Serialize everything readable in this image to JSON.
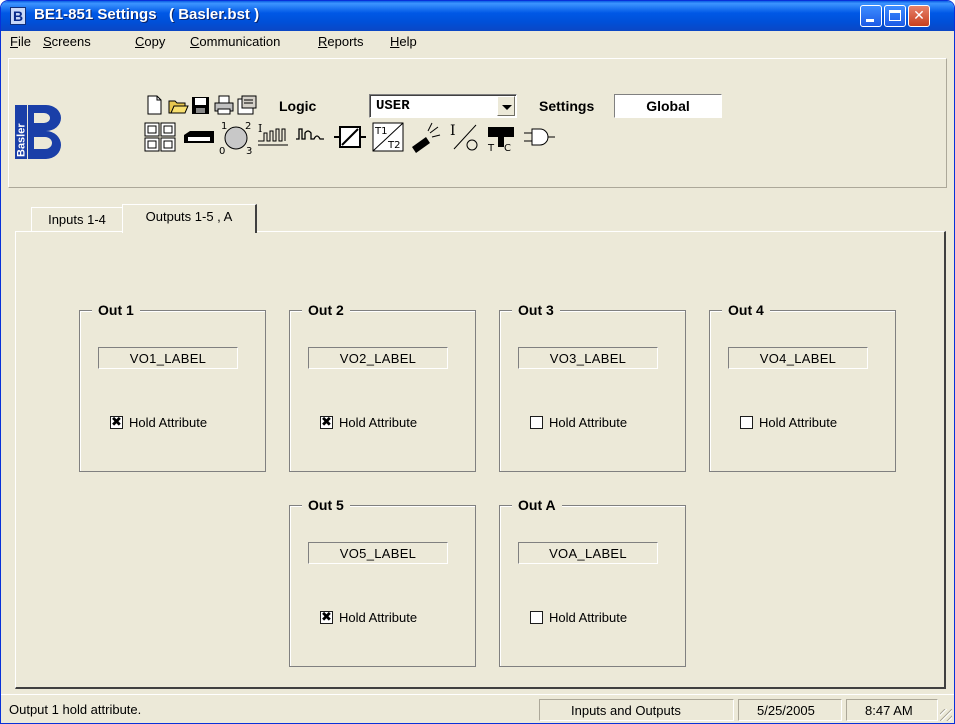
{
  "window": {
    "title": "BE1-851 Settings   ( Basler.bst )",
    "app_icon": "basler-b-icon"
  },
  "menu": [
    {
      "label": "File",
      "key": "F",
      "rest": "ile"
    },
    {
      "label": "Screens",
      "key": "S",
      "rest": "creens"
    },
    {
      "label": "Copy",
      "key": "C",
      "rest": "opy"
    },
    {
      "label": "Communication",
      "key": "C",
      "rest": "ommunication"
    },
    {
      "label": "Reports",
      "key": "R",
      "rest": "eports"
    },
    {
      "label": "Help",
      "key": "H",
      "rest": "elp"
    }
  ],
  "toolbar": {
    "logo_text": "Basler",
    "logic_label": "Logic",
    "logic_value": "USER",
    "settings_label": "Settings",
    "settings_value": "Global",
    "small_icons": [
      "new-file-icon",
      "open-folder-icon",
      "save-icon",
      "print-icon",
      "properties-icon"
    ],
    "screen_icons": [
      "inputs-outputs-icon",
      "relay-module-icon",
      "selector-switch-icon",
      "overcurrent-icon",
      "waveform-icon",
      "breaker-icon",
      "transformer-icon",
      "communication-icon",
      "fault-icon",
      "tc-coil-icon",
      "logic-gate-icon"
    ]
  },
  "tabs": {
    "inactive": "Inputs 1-4",
    "active": "Outputs 1-5 , A"
  },
  "outputs": [
    {
      "title": "Out 1",
      "label": "VO1_LABEL",
      "hold_text": "Hold Attribute",
      "checked": true
    },
    {
      "title": "Out 2",
      "label": "VO2_LABEL",
      "hold_text": "Hold Attribute",
      "checked": true
    },
    {
      "title": "Out 3",
      "label": "VO3_LABEL",
      "hold_text": "Hold Attribute",
      "checked": false
    },
    {
      "title": "Out 4",
      "label": "VO4_LABEL",
      "hold_text": "Hold Attribute",
      "checked": false
    },
    {
      "title": "Out 5",
      "label": "VO5_LABEL",
      "hold_text": "Hold Attribute",
      "checked": true
    },
    {
      "title": "Out A",
      "label": "VOA_LABEL",
      "hold_text": "Hold Attribute",
      "checked": false
    }
  ],
  "status": {
    "message": "Output 1 hold attribute.",
    "screen": "Inputs and Outputs",
    "date": "5/25/2005",
    "time": "8:47 AM"
  }
}
